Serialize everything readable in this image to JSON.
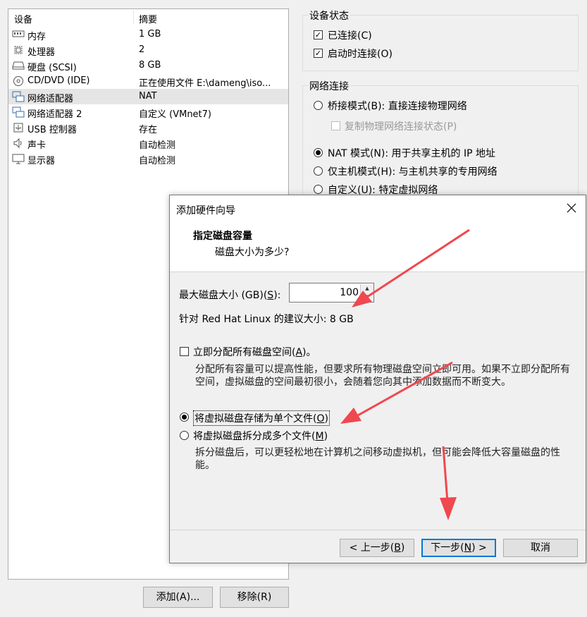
{
  "device_panel": {
    "col_device": "设备",
    "col_summary": "摘要",
    "rows": [
      {
        "icon": "memory-icon",
        "name": "内存",
        "summary": "1 GB"
      },
      {
        "icon": "processor-icon",
        "name": "处理器",
        "summary": "2"
      },
      {
        "icon": "hard-disk-icon",
        "name": "硬盘 (SCSI)",
        "summary": "8 GB"
      },
      {
        "icon": "cd-dvd-icon",
        "name": "CD/DVD (IDE)",
        "summary": "正在使用文件 E:\\dameng\\iso..."
      },
      {
        "icon": "network-adapter-icon",
        "name": "网络适配器",
        "summary": "NAT"
      },
      {
        "icon": "network-adapter-icon",
        "name": "网络适配器 2",
        "summary": "自定义 (VMnet7)"
      },
      {
        "icon": "usb-icon",
        "name": "USB 控制器",
        "summary": "存在"
      },
      {
        "icon": "sound-icon",
        "name": "声卡",
        "summary": "自动检测"
      },
      {
        "icon": "display-icon",
        "name": "显示器",
        "summary": "自动检测"
      }
    ],
    "selected_row": 4
  },
  "bottom_buttons": {
    "add": "添加(A)...",
    "remove": "移除(R)"
  },
  "device_status": {
    "title": "设备状态",
    "connected": "已连接(C)",
    "connect_on_power_on": "启动时连接(O)"
  },
  "network_connection": {
    "title": "网络连接",
    "bridged": "桥接模式(B): 直接连接物理网络",
    "replicate": "复制物理网络连接状态(P)",
    "nat": "NAT 模式(N): 用于共享主机的 IP 地址",
    "host_only": "仅主机模式(H): 与主机共享的专用网络",
    "custom": "自定义(U): 特定虚拟网络"
  },
  "wizard": {
    "title": "添加硬件向导",
    "heading": "指定磁盘容量",
    "subheading": "磁盘大小为多少?",
    "max_size_label_pre": "最大磁盘大小 (GB)(",
    "max_size_label_key": "S",
    "max_size_label_post": "):",
    "max_size_value": "100",
    "recommended": "针对 Red Hat Linux 的建议大小: 8 GB",
    "allocate_label_pre": "立即分配所有磁盘空间(",
    "allocate_label_key": "A",
    "allocate_label_post": ")。",
    "allocate_desc": "分配所有容量可以提高性能，但要求所有物理磁盘空间立即可用。如果不立即分配所有空间，虚拟磁盘的空间最初很小，会随着您向其中添加数据而不断变大。",
    "single_file_pre": "将虚拟磁盘存储为单个文件(",
    "single_file_key": "O",
    "single_file_post": ")",
    "split_pre": "将虚拟磁盘拆分成多个文件(",
    "split_key": "M",
    "split_post": ")",
    "split_desc": "拆分磁盘后，可以更轻松地在计算机之间移动虚拟机，但可能会降低大容量磁盘的性能。",
    "back_pre": "< 上一步(",
    "back_key": "B",
    "back_post": ")",
    "next_pre": "下一步(",
    "next_key": "N",
    "next_post": ") >",
    "cancel": "取消"
  },
  "colors": {
    "annotation_arrow": "#f0484f",
    "focus_border": "#0078d7"
  }
}
